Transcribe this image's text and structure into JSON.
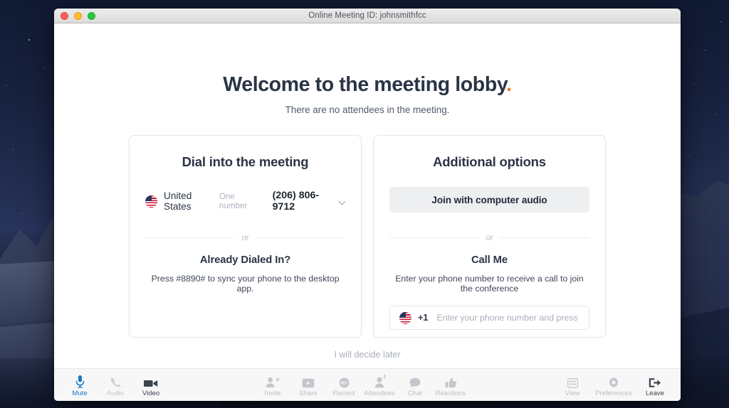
{
  "window": {
    "title": "Online Meeting ID: johnsmithfcc",
    "traffic_lights": [
      "close",
      "minimize",
      "maximize"
    ]
  },
  "lobby": {
    "heading": "Welcome to the meeting lobby",
    "heading_dot": ".",
    "subtitle": "There are no attendees in the meeting.",
    "decide_later": "I will decide later"
  },
  "dial_card": {
    "title": "Dial into the meeting",
    "country": "United States",
    "one_number_label": "One number",
    "phone_number": "(206) 806-9712",
    "divider_text": "or",
    "already_dialed_title": "Already Dialed In?",
    "already_dialed_desc": "Press #8890# to sync your phone to the desktop app."
  },
  "options_card": {
    "title": "Additional options",
    "join_computer_audio": "Join with computer audio",
    "divider_text": "or",
    "call_me_title": "Call Me",
    "call_me_desc": "Enter your phone number to receive a call to join the conference",
    "country_code": "+1",
    "phone_value": "",
    "phone_placeholder": "Enter your phone number and press \"Enter\""
  },
  "toolbar": {
    "left": [
      {
        "label": "Mute",
        "icon": "microphone-icon",
        "state": "active"
      },
      {
        "label": "Audio",
        "icon": "phone-icon",
        "state": "muted"
      },
      {
        "label": "Video",
        "icon": "video-camera-icon",
        "state": "dark"
      }
    ],
    "center": [
      {
        "label": "Invite",
        "icon": "person-add-icon",
        "state": "grey"
      },
      {
        "label": "Share",
        "icon": "screen-share-icon",
        "state": "grey"
      },
      {
        "label": "Record",
        "icon": "record-icon",
        "state": "grey"
      },
      {
        "label": "Attendees",
        "icon": "person-icon",
        "state": "grey",
        "badge": "1"
      },
      {
        "label": "Chat",
        "icon": "chat-bubble-icon",
        "state": "grey"
      },
      {
        "label": "Reactions",
        "icon": "thumbs-up-icon",
        "state": "grey"
      }
    ],
    "right": [
      {
        "label": "View",
        "icon": "grid-icon",
        "state": "grey"
      },
      {
        "label": "Preferences",
        "icon": "gear-icon",
        "state": "grey"
      },
      {
        "label": "Leave",
        "icon": "exit-icon",
        "state": "dark"
      }
    ]
  },
  "colors": {
    "accent_orange": "#f07c22",
    "accent_blue": "#1776c8",
    "heading": "#2b3445",
    "muted_text": "#a8aeb9"
  }
}
